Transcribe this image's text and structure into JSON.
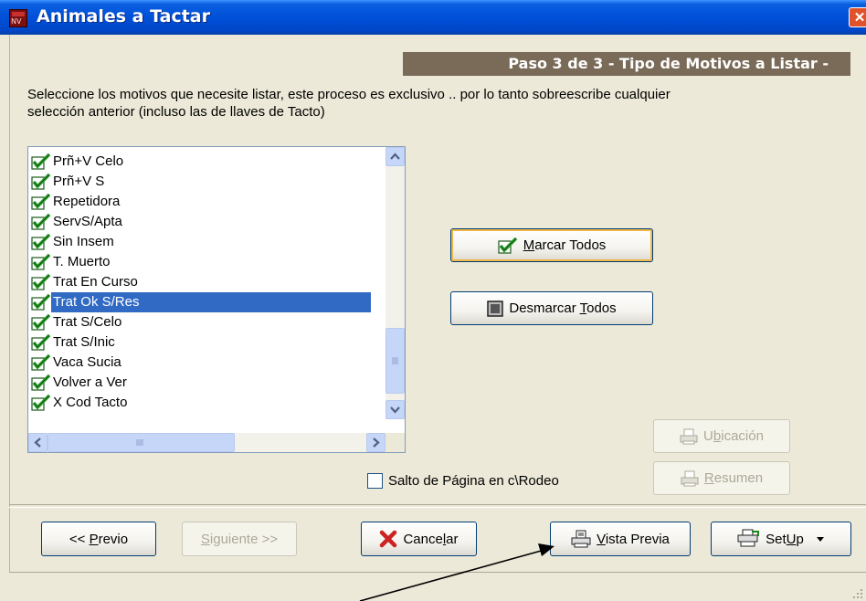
{
  "window": {
    "title": "Animales a Tactar",
    "close_glyph": "✕",
    "icon_text": "NV"
  },
  "step_banner": "Paso 3 de 3  - Tipo de Motivos a Listar -",
  "instructions": "Seleccione los motivos que necesite listar, este proceso es exclusivo .. por lo tanto sobreescribe cualquier selección anterior (incluso las de llaves de Tacto)",
  "list": {
    "items": [
      {
        "label": "Prñ+V Celo",
        "checked": true
      },
      {
        "label": "Prñ+V S",
        "checked": true
      },
      {
        "label": "Repetidora",
        "checked": true
      },
      {
        "label": "ServS/Apta",
        "checked": true
      },
      {
        "label": "Sin Insem",
        "checked": true
      },
      {
        "label": "T. Muerto",
        "checked": true
      },
      {
        "label": "Trat En Curso",
        "checked": true
      },
      {
        "label": "Trat Ok S/Res",
        "checked": true,
        "selected": true
      },
      {
        "label": "Trat S/Celo",
        "checked": true
      },
      {
        "label": "Trat S/Inic",
        "checked": true
      },
      {
        "label": "Vaca Sucia",
        "checked": true
      },
      {
        "label": "Volver a Ver",
        "checked": true
      },
      {
        "label": "X Cod Tacto",
        "checked": true
      }
    ],
    "selection_color": "#316ac5"
  },
  "buttons": {
    "marcar_todos": {
      "pre": "",
      "u": "M",
      "post": "arcar Todos"
    },
    "desmarcar_todos": {
      "pre": "Desmarcar ",
      "u": "T",
      "post": "odos"
    },
    "ubicacion": {
      "pre": "U",
      "u": "b",
      "post": "icación"
    },
    "resumen": {
      "pre": "",
      "u": "R",
      "post": "esumen"
    },
    "previo": {
      "pre": "<< ",
      "u": "P",
      "post": "revio"
    },
    "siguiente": {
      "pre": "",
      "u": "S",
      "post": "iguiente >>"
    },
    "cancelar": {
      "pre": "Cance",
      "u": "l",
      "post": "ar"
    },
    "vista_previa": {
      "pre": "",
      "u": "V",
      "post": "ista Previa"
    },
    "setup": {
      "pre": "Set",
      "u": "U",
      "post": "p"
    }
  },
  "checkbox": {
    "label": "Salto de Página en c\\Rodeo",
    "checked": false
  },
  "colors": {
    "titlebar": "#0050d8",
    "dialog_bg": "#ece9d8",
    "banner_bg": "#7a6a58",
    "check_green": "#2fa52f",
    "cancel_red": "#cc2222"
  },
  "icons": {
    "check": "check-icon",
    "uncheck": "uncheck-icon",
    "printer": "printer-icon",
    "cancel": "cancel-x-icon",
    "setup": "setup-icon",
    "dropdown": "dropdown-arrow-icon",
    "annotation": "annotation-arrow"
  }
}
